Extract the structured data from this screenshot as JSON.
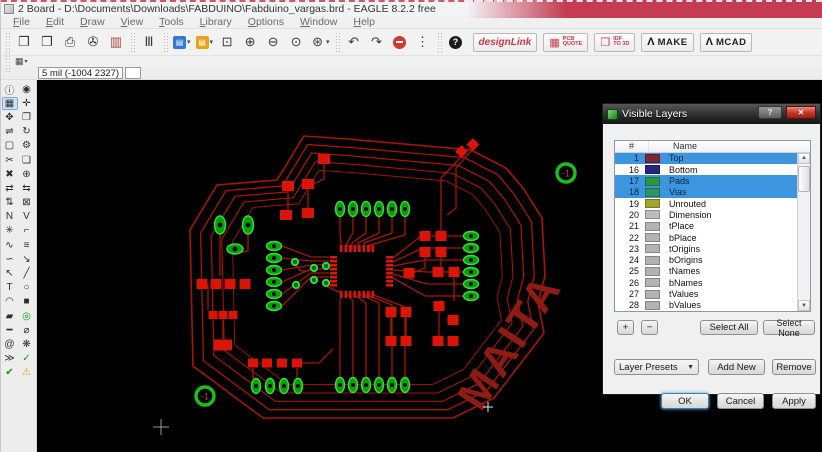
{
  "window": {
    "title": "2 Board - D:\\Documents\\Downloads\\FABDUINO\\Fabduino_vargas.brd - EAGLE 8.2.2 free"
  },
  "menus": [
    "File",
    "Edit",
    "Draw",
    "View",
    "Tools",
    "Library",
    "Options",
    "Window",
    "Help"
  ],
  "toolbar": {
    "icons": [
      {
        "type": "grip"
      },
      {
        "type": "btn",
        "name": "open",
        "glyph": "❐"
      },
      {
        "type": "btn",
        "name": "save",
        "glyph": "❒"
      },
      {
        "type": "btn",
        "name": "print",
        "glyph": "⎙"
      },
      {
        "type": "btn",
        "name": "cam-processor",
        "glyph": "✇"
      },
      {
        "type": "btn",
        "name": "board-schematic-toggle",
        "glyph": "▥",
        "color": "#a8493f"
      },
      {
        "type": "grip"
      },
      {
        "type": "btn",
        "name": "library",
        "glyph": "Ⅲ"
      },
      {
        "type": "grip"
      },
      {
        "type": "chip",
        "name": "run-script",
        "glyph": "▤",
        "bg": "#2e7bd6"
      },
      {
        "type": "chip",
        "name": "run-ulp",
        "glyph": "▤",
        "bg": "#e8a31e"
      },
      {
        "type": "btn",
        "name": "zoom-fit",
        "glyph": "⊡"
      },
      {
        "type": "btn",
        "name": "zoom-in",
        "glyph": "⊕"
      },
      {
        "type": "btn",
        "name": "zoom-out",
        "glyph": "⊖"
      },
      {
        "type": "btn",
        "name": "zoom-select",
        "glyph": "⊙"
      },
      {
        "type": "chip2",
        "name": "zoom-redraw",
        "glyph": "⊛"
      },
      {
        "type": "grip"
      },
      {
        "type": "btn",
        "name": "undo",
        "glyph": "↶"
      },
      {
        "type": "btn",
        "name": "redo",
        "glyph": "↷"
      },
      {
        "type": "stop",
        "name": "stop"
      },
      {
        "type": "btn",
        "name": "more-options",
        "glyph": "⋮"
      },
      {
        "type": "grip"
      },
      {
        "type": "help",
        "name": "help",
        "glyph": "?"
      }
    ],
    "promos": {
      "design_link": "designLink",
      "pcb_quote_line1": "PCB",
      "pcb_quote_line2": "QUOTE",
      "idf_line1": "IDF",
      "idf_line2": "TO 3D",
      "autodesk_glyph": "Λ",
      "make": "MAKE",
      "mcad": "MCAD"
    }
  },
  "toolbar2": {
    "grid_glyph": "▦",
    "dropdown_glyph": "▾"
  },
  "commandbar": {
    "coordinates": "5 mil (-1004 2327)",
    "command_value": ""
  },
  "sidebar": {
    "tools": [
      {
        "name": "info",
        "glyph": "ⓘ"
      },
      {
        "name": "show",
        "glyph": "◉"
      },
      {
        "name": "display-layers",
        "glyph": "▦",
        "class": "sel"
      },
      {
        "name": "mark",
        "glyph": "✛"
      },
      {
        "name": "move",
        "glyph": "✥"
      },
      {
        "name": "copy",
        "glyph": "❐"
      },
      {
        "name": "mirror",
        "glyph": "⇌"
      },
      {
        "name": "rotate",
        "glyph": "↻"
      },
      {
        "name": "group",
        "glyph": "▢"
      },
      {
        "name": "change",
        "glyph": "⚙"
      },
      {
        "name": "cut",
        "glyph": "✂"
      },
      {
        "name": "paste",
        "glyph": "❏"
      },
      {
        "name": "delete",
        "glyph": "✖"
      },
      {
        "name": "add-part",
        "glyph": "⊕"
      },
      {
        "name": "pinswap",
        "glyph": "⇄"
      },
      {
        "name": "replace",
        "glyph": "⇆"
      },
      {
        "name": "gateswap",
        "glyph": "⇅"
      },
      {
        "name": "lock",
        "glyph": "⊠"
      },
      {
        "name": "name",
        "glyph": "N"
      },
      {
        "name": "value",
        "glyph": "V"
      },
      {
        "name": "smash",
        "glyph": "✳"
      },
      {
        "name": "miter",
        "glyph": "⌐"
      },
      {
        "name": "split",
        "glyph": "∿"
      },
      {
        "name": "optimize",
        "glyph": "≡"
      },
      {
        "name": "meander",
        "glyph": "∽"
      },
      {
        "name": "route",
        "glyph": "↘"
      },
      {
        "name": "ripup",
        "glyph": "↖"
      },
      {
        "name": "wire",
        "glyph": "╱"
      },
      {
        "name": "text",
        "glyph": "T"
      },
      {
        "name": "circle",
        "glyph": "○"
      },
      {
        "name": "arc",
        "glyph": "◠"
      },
      {
        "name": "rect",
        "glyph": "■"
      },
      {
        "name": "polygon",
        "glyph": "▰"
      },
      {
        "name": "via",
        "glyph": "◎",
        "class": "green"
      },
      {
        "name": "signal",
        "glyph": "━"
      },
      {
        "name": "hole",
        "glyph": "⌀"
      },
      {
        "name": "attribute",
        "glyph": "@"
      },
      {
        "name": "ratsnest",
        "glyph": "❋"
      },
      {
        "name": "autorouter",
        "glyph": "≫"
      },
      {
        "name": "erc",
        "glyph": "✓",
        "class": "green"
      },
      {
        "name": "drc",
        "glyph": "✔",
        "class": "green"
      },
      {
        "name": "errors",
        "glyph": "⚠",
        "class": "yellow"
      }
    ]
  },
  "canvas": {
    "board_label": "MAITA",
    "marker_label": "-1",
    "colors": {
      "background": "#000000",
      "top_trace": "#a81408",
      "smd_pad": "#dc1408",
      "tht_pad_green": "#0a9e0a",
      "pad_ring": "#35e035"
    }
  },
  "dialog": {
    "title": "Visible Layers",
    "help_glyph": "?",
    "close_glyph": "✕",
    "columns": {
      "number": "#",
      "name": "Name"
    },
    "layers": [
      {
        "num": "1",
        "name": "Top",
        "color": "#7c2636",
        "selected": true
      },
      {
        "num": "16",
        "name": "Bottom",
        "color": "#26267f",
        "selected": false
      },
      {
        "num": "17",
        "name": "Pads",
        "color": "#2e9440",
        "selected": true
      },
      {
        "num": "18",
        "name": "Vias",
        "color": "#2e9463",
        "selected": true
      },
      {
        "num": "19",
        "name": "Unrouted",
        "color": "#a3a32b",
        "selected": false
      },
      {
        "num": "20",
        "name": "Dimension",
        "color": "#bcbcbc",
        "selected": false
      },
      {
        "num": "21",
        "name": "tPlace",
        "color": "#b2b2b2",
        "selected": false
      },
      {
        "num": "22",
        "name": "bPlace",
        "color": "#b2b2b2",
        "selected": false
      },
      {
        "num": "23",
        "name": "tOrigins",
        "color": "#b2b2b2",
        "selected": false
      },
      {
        "num": "24",
        "name": "bOrigins",
        "color": "#b2b2b2",
        "selected": false
      },
      {
        "num": "25",
        "name": "tNames",
        "color": "#b2b2b2",
        "selected": false
      },
      {
        "num": "26",
        "name": "bNames",
        "color": "#b2b2b2",
        "selected": false
      },
      {
        "num": "27",
        "name": "tValues",
        "color": "#b2b2b2",
        "selected": false
      },
      {
        "num": "28",
        "name": "bValues",
        "color": "#b2b2b2",
        "selected": false
      }
    ],
    "buttons": {
      "plus": "+",
      "minus": "−",
      "select_all": "Select All",
      "select_none": "Select None",
      "layer_presets": "Layer Presets",
      "add_new": "Add New",
      "remove": "Remove",
      "ok": "OK",
      "cancel": "Cancel",
      "apply": "Apply"
    },
    "selection_color": "#3d95e0"
  }
}
